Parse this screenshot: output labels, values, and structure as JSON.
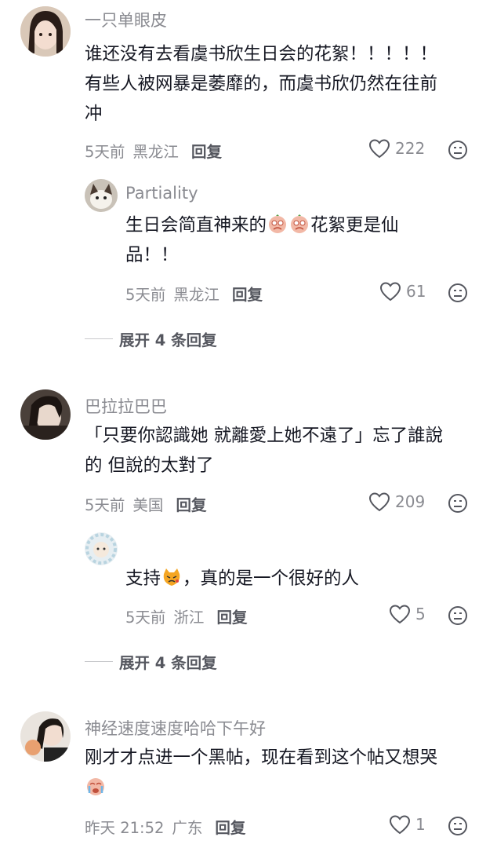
{
  "comments": [
    {
      "username": "一只单眼皮",
      "text_lines": [
        "谁还没有去看虞书欣生日会的花絮！！！！！",
        "有些人被网暴是萎靡的，而虞书欣仍然在往前",
        "冲"
      ],
      "time": "5天前",
      "location": "黑龙江",
      "reply_label": "回复",
      "likes": "222"
    },
    {
      "username": "Partiality",
      "text_before_emoji": "生日会简直神来的",
      "emoji": "crying-face-emoji",
      "text_after_emoji": "花絮更是仙",
      "text_line2": "品！！",
      "time": "5天前",
      "location": "黑龙江",
      "reply_label": "回复",
      "likes": "61"
    },
    {
      "username": "巴拉拉巴巴",
      "text_lines": [
        "「只要你認識她 就離愛上她不遠了」忘了誰說",
        "的 但說的太對了"
      ],
      "time": "5天前",
      "location": "美国",
      "reply_label": "回复",
      "likes": "209"
    },
    {
      "username": "",
      "text_before_emoji": "支持",
      "emoji": "angry-cat-emoji",
      "text_after_emoji": "，真的是一个很好的人",
      "time": "5天前",
      "location": "浙江",
      "reply_label": "回复",
      "likes": "5"
    },
    {
      "username": "神经速度速度哈哈下午好",
      "text_lines": [
        "刚才才点进一个黑帖，现在看到这个帖又想哭"
      ],
      "emoji": "crying-emoji",
      "time": "昨天 21:52",
      "location": "广东",
      "reply_label": "回复",
      "likes": "1"
    }
  ],
  "expand_replies": [
    "展开 4 条回复",
    "展开 4 条回复"
  ],
  "colors": {
    "text": "#161823",
    "meta": "#8a8b91",
    "reply": "#55575f"
  }
}
